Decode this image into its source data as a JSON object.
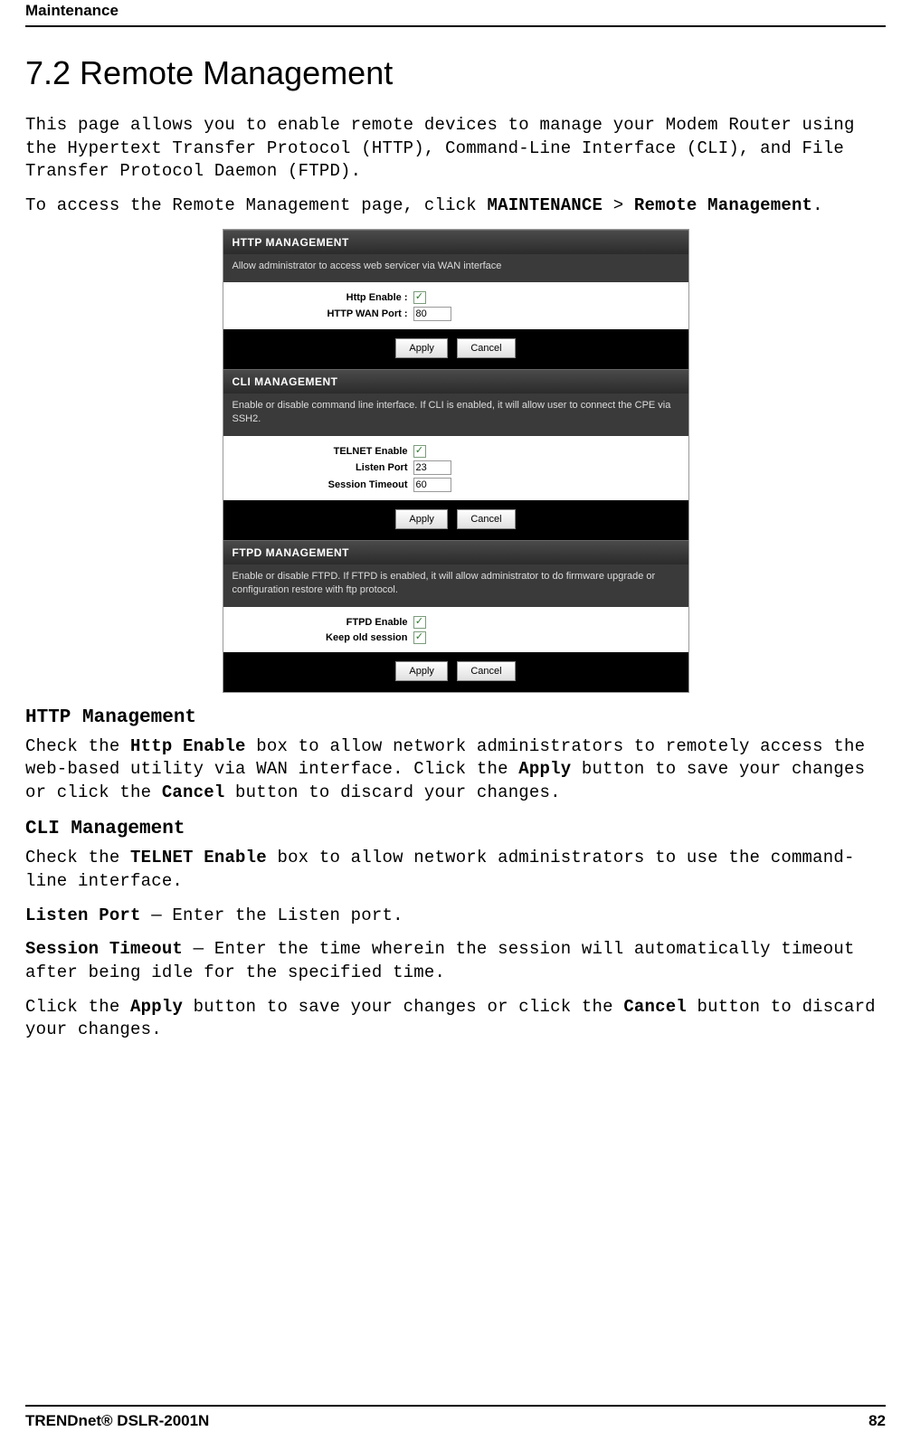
{
  "header": {
    "chapter": "Maintenance"
  },
  "title": "7.2   Remote Management",
  "intro1": "This page allows you to enable remote devices to manage your Modem Router using the Hypertext Transfer Protocol (HTTP), Command-Line Interface (CLI), and File Transfer Protocol Daemon (FTPD).",
  "intro2_pre": "To access the Remote Management page, click ",
  "intro2_b1": "MAINTENANCE",
  "intro2_mid": " > ",
  "intro2_b2": "Remote Management",
  "intro2_post": ".",
  "screenshot": {
    "http": {
      "title": "HTTP MANAGEMENT",
      "desc": "Allow administrator to access web servicer via WAN interface",
      "enable_label": "Http Enable  :",
      "enable_checked": true,
      "port_label": "HTTP WAN Port  :",
      "port_value": "80",
      "apply": "Apply",
      "cancel": "Cancel"
    },
    "cli": {
      "title": "CLI MANAGEMENT",
      "desc": "Enable or disable command line interface. If CLI is enabled, it will allow user to connect the CPE via SSH2.",
      "telnet_label": "TELNET Enable",
      "telnet_checked": true,
      "listen_label": "Listen Port",
      "listen_value": "23",
      "timeout_label": "Session Timeout",
      "timeout_value": "60",
      "apply": "Apply",
      "cancel": "Cancel"
    },
    "ftpd": {
      "title": "FTPD MANAGEMENT",
      "desc": "Enable or disable FTPD. If FTPD is enabled, it will allow administrator to do firmware upgrade or configuration restore with ftp protocol.",
      "enable_label": "FTPD Enable",
      "enable_checked": true,
      "keep_label": "Keep old session",
      "keep_checked": true,
      "apply": "Apply",
      "cancel": "Cancel"
    }
  },
  "sections": {
    "http": {
      "heading": "HTTP Management",
      "p1_a": "Check the ",
      "p1_b1": "Http Enable",
      "p1_b": " box to allow network administrators to remotely access the web-based utility via WAN interface. Click the ",
      "p1_b2": "Apply",
      "p1_c": " button to save your changes or click the ",
      "p1_b3": "Cancel",
      "p1_d": " button to discard your changes."
    },
    "cli": {
      "heading": "CLI Management",
      "p1_a": "Check the ",
      "p1_b1": "TELNET Enable",
      "p1_b": " box to allow network administrators to use the command-line interface.",
      "p2_b1": "Listen Port",
      "p2_a": " — Enter the Listen port.",
      "p3_b1": "Session Timeout",
      "p3_a": " — Enter the time wherein the session will automatically timeout after being idle for the specified time.",
      "p4_a": "Click the ",
      "p4_b1": "Apply",
      "p4_b": " button to save your changes or click the ",
      "p4_b2": "Cancel",
      "p4_c": " button to discard your changes."
    }
  },
  "footer": {
    "left": "TRENDnet® DSLR-2001N",
    "right": "82"
  }
}
